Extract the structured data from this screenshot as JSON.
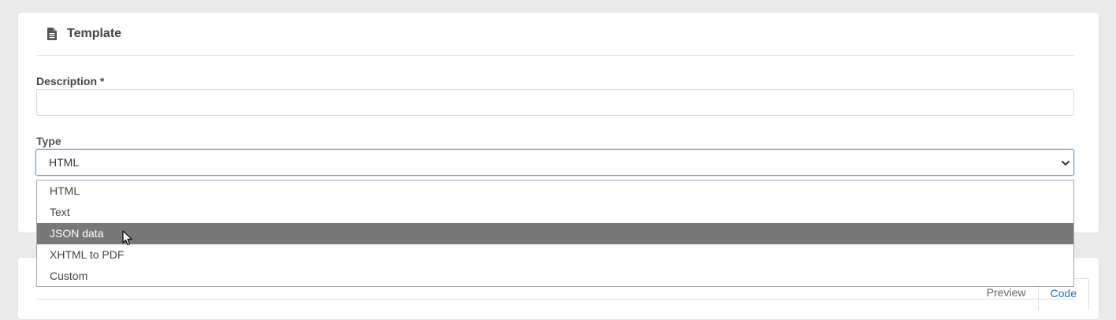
{
  "card": {
    "title": "Template",
    "icon": "file-text-icon"
  },
  "form": {
    "description_label": "Description *",
    "description_value": "",
    "type_label": "Type",
    "type_value": "HTML"
  },
  "dropdown": {
    "options": [
      "HTML",
      "Text",
      "JSON data",
      "XHTML to PDF",
      "Custom"
    ],
    "highlighted": "JSON data"
  },
  "tabs": {
    "preview": "Preview",
    "code": "Code"
  },
  "colors": {
    "highlight_bg": "#787878",
    "focus_border": "#6ea3dd",
    "link": "#2a6db5"
  }
}
